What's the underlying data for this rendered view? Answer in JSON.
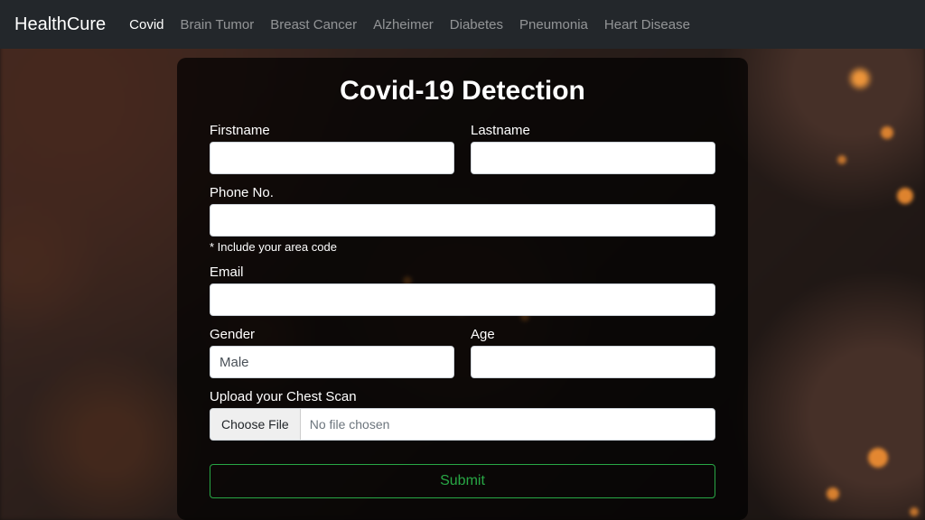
{
  "nav": {
    "brand": "HealthCure",
    "items": [
      {
        "label": "Covid",
        "active": true
      },
      {
        "label": "Brain Tumor",
        "active": false
      },
      {
        "label": "Breast Cancer",
        "active": false
      },
      {
        "label": "Alzheimer",
        "active": false
      },
      {
        "label": "Diabetes",
        "active": false
      },
      {
        "label": "Pneumonia",
        "active": false
      },
      {
        "label": "Heart Disease",
        "active": false
      }
    ]
  },
  "form": {
    "title": "Covid-19 Detection",
    "firstname_label": "Firstname",
    "firstname_value": "",
    "lastname_label": "Lastname",
    "lastname_value": "",
    "phone_label": "Phone No.",
    "phone_value": "",
    "phone_hint": "* Include your area code",
    "email_label": "Email",
    "email_value": "",
    "gender_label": "Gender",
    "gender_value": "Male",
    "age_label": "Age",
    "age_value": "",
    "upload_label": "Upload your Chest Scan",
    "choose_file_label": "Choose File",
    "no_file_text": "No file chosen",
    "submit_label": "Submit"
  }
}
